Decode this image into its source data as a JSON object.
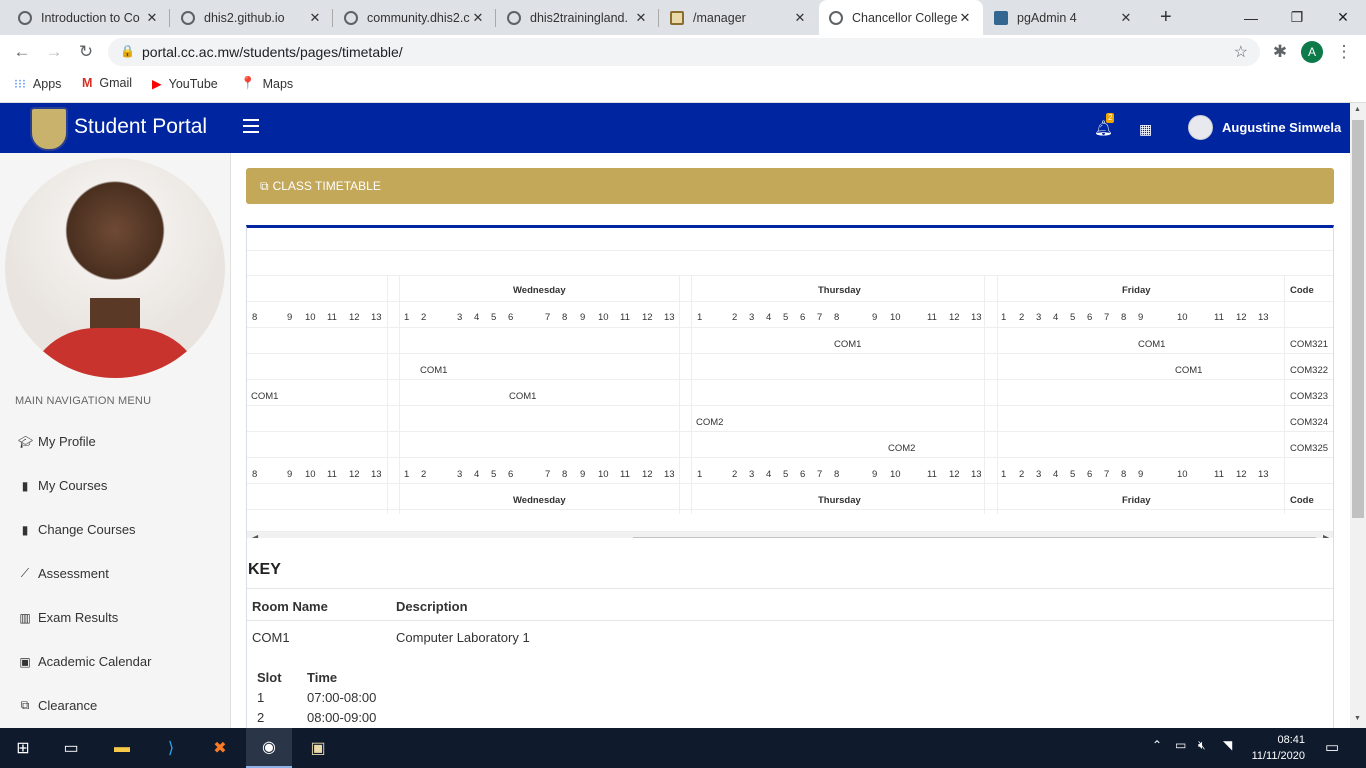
{
  "browser": {
    "tabs": [
      {
        "title": "Introduction to Co",
        "icon": "globe-icon"
      },
      {
        "title": "dhis2.github.io",
        "icon": "globe-icon"
      },
      {
        "title": "community.dhis2.c",
        "icon": "globe-icon"
      },
      {
        "title": "dhis2trainingland.",
        "icon": "globe-icon"
      },
      {
        "title": "/manager",
        "icon": "manager-icon"
      },
      {
        "title": "Chancellor College",
        "icon": "globe-icon"
      },
      {
        "title": "pgAdmin 4",
        "icon": "pgadmin-icon"
      }
    ],
    "new_tab_label": "+",
    "url": "portal.cc.ac.mw/students/pages/timetable/",
    "profile_initial": "A",
    "bookmarks": [
      "Apps",
      "Gmail",
      "YouTube",
      "Maps"
    ]
  },
  "header": {
    "brand": "Student Portal",
    "notification_count": "2",
    "user_name": "Augustine Simwela"
  },
  "sidebar": {
    "menu_heading": "MAIN NAVIGATION MENU",
    "items": [
      {
        "label": "My Profile",
        "icon": "graduation-cap-icon"
      },
      {
        "label": "My Courses",
        "icon": "book-icon"
      },
      {
        "label": "Change Courses",
        "icon": "book-icon"
      },
      {
        "label": "Assessment",
        "icon": "line-chart-icon"
      },
      {
        "label": "Exam Results",
        "icon": "bar-chart-icon"
      },
      {
        "label": "Academic Calendar",
        "icon": "calendar-check-icon"
      },
      {
        "label": "Clearance",
        "icon": "copy-icon"
      }
    ]
  },
  "page": {
    "title": "CLASS TIMETABLE"
  },
  "timetable": {
    "days": [
      "Wednesday",
      "Thursday",
      "Friday"
    ],
    "code_header": "Code",
    "slot_row": [
      "8",
      "9",
      "10",
      "11",
      "12",
      "13",
      "1",
      "2",
      "3",
      "4",
      "5",
      "6",
      "7",
      "8",
      "9",
      "10",
      "11",
      "12",
      "13",
      "1",
      "2",
      "3",
      "4",
      "5",
      "6",
      "7",
      "8",
      "9",
      "10",
      "11",
      "12",
      "13",
      "1",
      "2",
      "3",
      "4",
      "5",
      "6",
      "7",
      "8",
      "9",
      "10",
      "11",
      "12",
      "13"
    ],
    "entries": [
      {
        "code": "COM321",
        "cells": [
          "COM1",
          "COM1"
        ]
      },
      {
        "code": "COM322",
        "cells": [
          "COM1",
          "COM1"
        ]
      },
      {
        "code": "COM323",
        "cells": [
          "COM1",
          "COM1"
        ]
      },
      {
        "code": "COM324",
        "cells": [
          "COM2"
        ]
      },
      {
        "code": "COM325",
        "cells": [
          "COM2"
        ]
      }
    ]
  },
  "key": {
    "heading": "KEY",
    "room_header": "Room Name",
    "desc_header": "Description",
    "rooms": [
      {
        "name": "COM1",
        "description": "Computer Laboratory 1"
      }
    ],
    "slot_header": "Slot",
    "time_header": "Time",
    "slots": [
      {
        "slot": "1",
        "time": "07:00-08:00"
      },
      {
        "slot": "2",
        "time": "08:00-09:00"
      }
    ]
  },
  "taskbar": {
    "time": "08:41",
    "date": "11/11/2020"
  }
}
